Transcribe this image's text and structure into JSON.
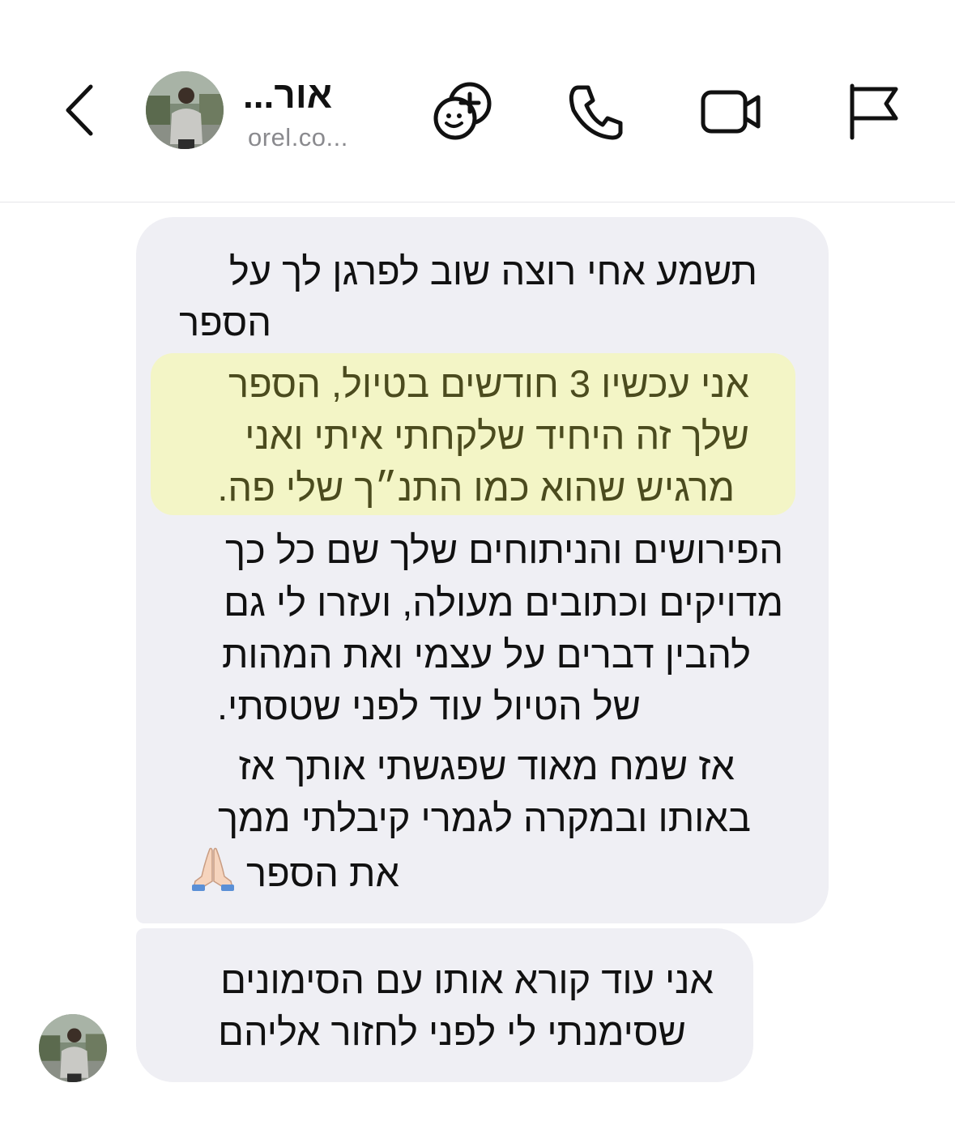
{
  "header": {
    "contact_name": "אור...",
    "contact_handle": "orel.co..."
  },
  "icons": {
    "back": "chevron-left-icon",
    "avatar": "profile-photo",
    "games": "game-add-icon",
    "call": "phone-icon",
    "video": "video-camera-icon",
    "report": "flag-icon",
    "emoji": "folded-hands-emoji"
  },
  "messages": [
    {
      "lines": [
        "תשמע אחי רוצה שוב לפרגן לך על",
        "הספר"
      ],
      "highlighted_lines": [
        "אני עכשיו 3 חודשים בטיול, הספר",
        "שלך זה היחיד שלקחתי איתי ואני",
        "מרגיש שהוא כמו התנ״ך שלי פה."
      ],
      "more_lines": [
        "הפירושים והניתוחים שלך שם כל כך",
        "מדויקים וכתובים מעולה, ועזרו לי גם",
        "להבין דברים על עצמי ואת המהות",
        "של הטיול עוד לפני שטסתי.",
        "אז שמח מאוד שפגשתי אותך אז",
        "באותו ובמקרה לגמרי קיבלתי ממך",
        "את הספר"
      ]
    },
    {
      "lines": [
        "אני עוד קורא אותו עם הסימונים",
        "שסימנתי לי לפני לחזור אליהם"
      ]
    }
  ],
  "colors": {
    "bubble": "#efeff4",
    "highlight": "#f3f5c6",
    "highlight_text": "#4b4b1e"
  }
}
